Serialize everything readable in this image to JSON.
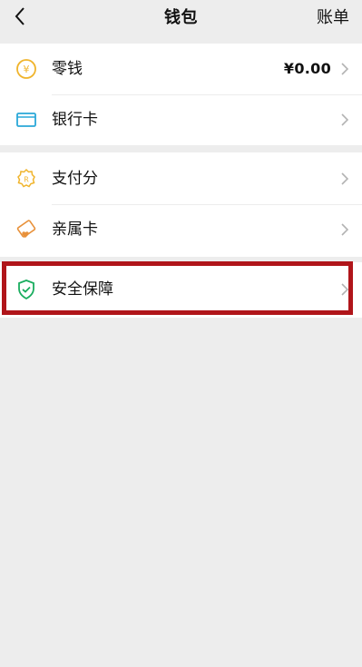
{
  "header": {
    "title": "钱包",
    "right_label": "账单"
  },
  "groups": [
    {
      "items": [
        {
          "label": "零钱",
          "value": "¥0.00",
          "icon": "change-coin-icon",
          "icon_color": "#f0b42c"
        },
        {
          "label": "银行卡",
          "value": "",
          "icon": "bank-card-icon",
          "icon_color": "#2aa8d8"
        }
      ]
    },
    {
      "items": [
        {
          "label": "支付分",
          "value": "",
          "icon": "pay-score-icon",
          "icon_color": "#f0b42c"
        },
        {
          "label": "亲属卡",
          "value": "",
          "icon": "family-card-icon",
          "icon_color": "#e8913a"
        }
      ]
    },
    {
      "items": [
        {
          "label": "安全保障",
          "value": "",
          "icon": "security-shield-icon",
          "icon_color": "#1aad5f"
        }
      ]
    }
  ],
  "highlight": {
    "color": "#b0151a",
    "target": "安全保障"
  },
  "colors": {
    "background": "#ededed",
    "card": "#ffffff",
    "text": "#111111",
    "chevron": "#b2b2b2",
    "link": "#576b95"
  }
}
